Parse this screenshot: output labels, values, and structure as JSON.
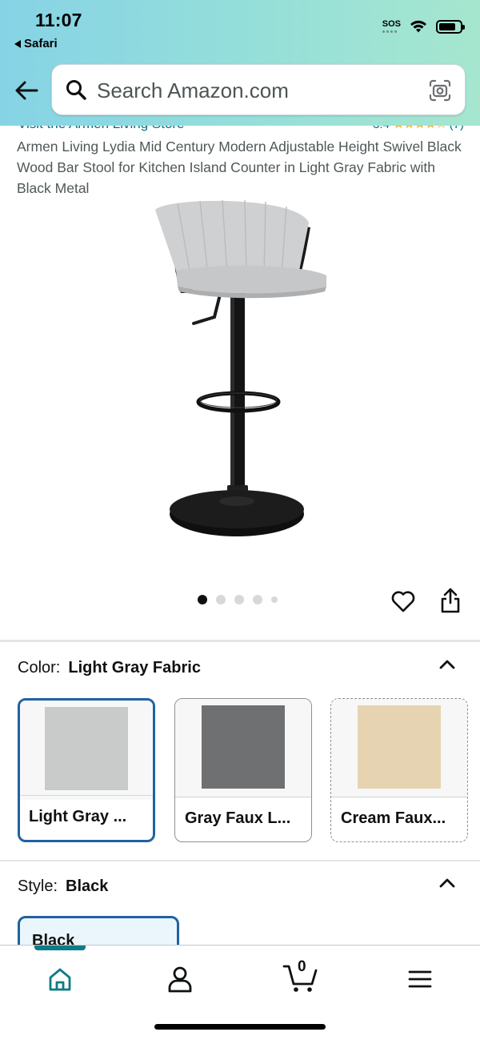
{
  "status_bar": {
    "time": "11:07",
    "back_app": "Safari",
    "sos": "SOS"
  },
  "header": {
    "search_placeholder": "Search Amazon.com",
    "icons": [
      "back-arrow-icon",
      "search-icon",
      "camera-scan-icon"
    ]
  },
  "product": {
    "store_link": "Visit the Armen Living Store",
    "rating_value": "3.4",
    "rating_stars": "★★★★☆",
    "rating_count": "(7)",
    "title": "Armen Living Lydia Mid Century Modern Adjustable Height Swivel Black Wood Bar Stool for Kitchen Island Counter in Light Gray Fabric with Black Metal",
    "image_count": 5,
    "active_image_index": 0
  },
  "color_section": {
    "label": "Color:",
    "selected_value": "Light Gray Fabric",
    "options": [
      {
        "label": "Light Gray ...",
        "color": "#c9cbca",
        "selected": true,
        "available": true
      },
      {
        "label": "Gray Faux L...",
        "color": "#6f7072",
        "selected": false,
        "available": true
      },
      {
        "label": "Cream Faux...",
        "color": "#e6d3b1",
        "selected": false,
        "available": false
      }
    ]
  },
  "style_section": {
    "label": "Style:",
    "selected_value": "Black",
    "options": [
      {
        "label": "Black",
        "selected": true
      }
    ]
  },
  "bottom_nav": {
    "items": [
      "home-icon",
      "account-icon",
      "cart-icon",
      "menu-icon"
    ],
    "cart_count": "0",
    "active": "home"
  },
  "colors": {
    "link": "#007185",
    "star": "#f4a41d",
    "selected_border": "#2162a1",
    "nav_active": "#0e7c86"
  }
}
